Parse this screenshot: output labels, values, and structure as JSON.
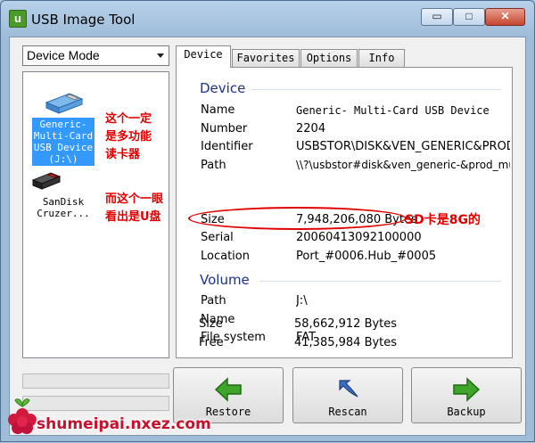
{
  "window": {
    "title": "USB Image Tool",
    "app_icon_letter": "u",
    "min_glyph": "▭",
    "max_glyph": "□",
    "close_glyph": "✕"
  },
  "left": {
    "mode_select": "Device Mode",
    "devices": [
      {
        "label": "Generic-\nMulti-Card\nUSB Device\n(J:\\)",
        "selected": true,
        "icon": "usb-drive-blue-icon"
      },
      {
        "label": "SanDisk\nCruzer...",
        "selected": false,
        "icon": "usb-drive-black-icon"
      }
    ],
    "annotation1": [
      "这个一定",
      "是多功能",
      "读卡器"
    ],
    "annotation2": [
      "而这个一眼",
      "看出是U盘"
    ]
  },
  "tabs": [
    "Device",
    "Favorites",
    "Options",
    "Info"
  ],
  "device_group": {
    "heading": "Device",
    "rows": [
      {
        "label": "Name",
        "value": "Generic- Multi-Card USB Device"
      },
      {
        "label": "Number",
        "value": "2204"
      },
      {
        "label": "Identifier",
        "value": "USBSTOR\\DISK&VEN_GENERIC&PROD"
      },
      {
        "label": "Path",
        "value": "\\\\?\\usbstor#disk&ven_generic-&prod_multi-"
      },
      {
        "label": "Size",
        "value": "7,948,206,080 Bytes"
      },
      {
        "label": "Serial",
        "value": "20060413092100000"
      },
      {
        "label": "Location",
        "value": "Port_#0006.Hub_#0005"
      }
    ],
    "size_annotation": "SD卡是8G的"
  },
  "volume_group": {
    "heading": "Volume",
    "rows": [
      {
        "label": "Path",
        "value": "J:\\"
      },
      {
        "label": "Name",
        "value": ""
      },
      {
        "label": "File system",
        "value": "FAT"
      },
      {
        "label": "Size",
        "value": "58,662,912 Bytes"
      },
      {
        "label": "Free",
        "value": "41,385,984 Bytes"
      }
    ]
  },
  "buttons": {
    "restore": "Restore",
    "rescan": "Rescan",
    "backup": "Backup"
  },
  "watermark": "shumeipai.nxez.com",
  "colors": {
    "annotation_red": "#e00000",
    "selection_blue": "#3399ff",
    "group_heading": "#1e3287",
    "arrow_green": "#3ea42a",
    "rescan_blue": "#3b6fc4"
  }
}
